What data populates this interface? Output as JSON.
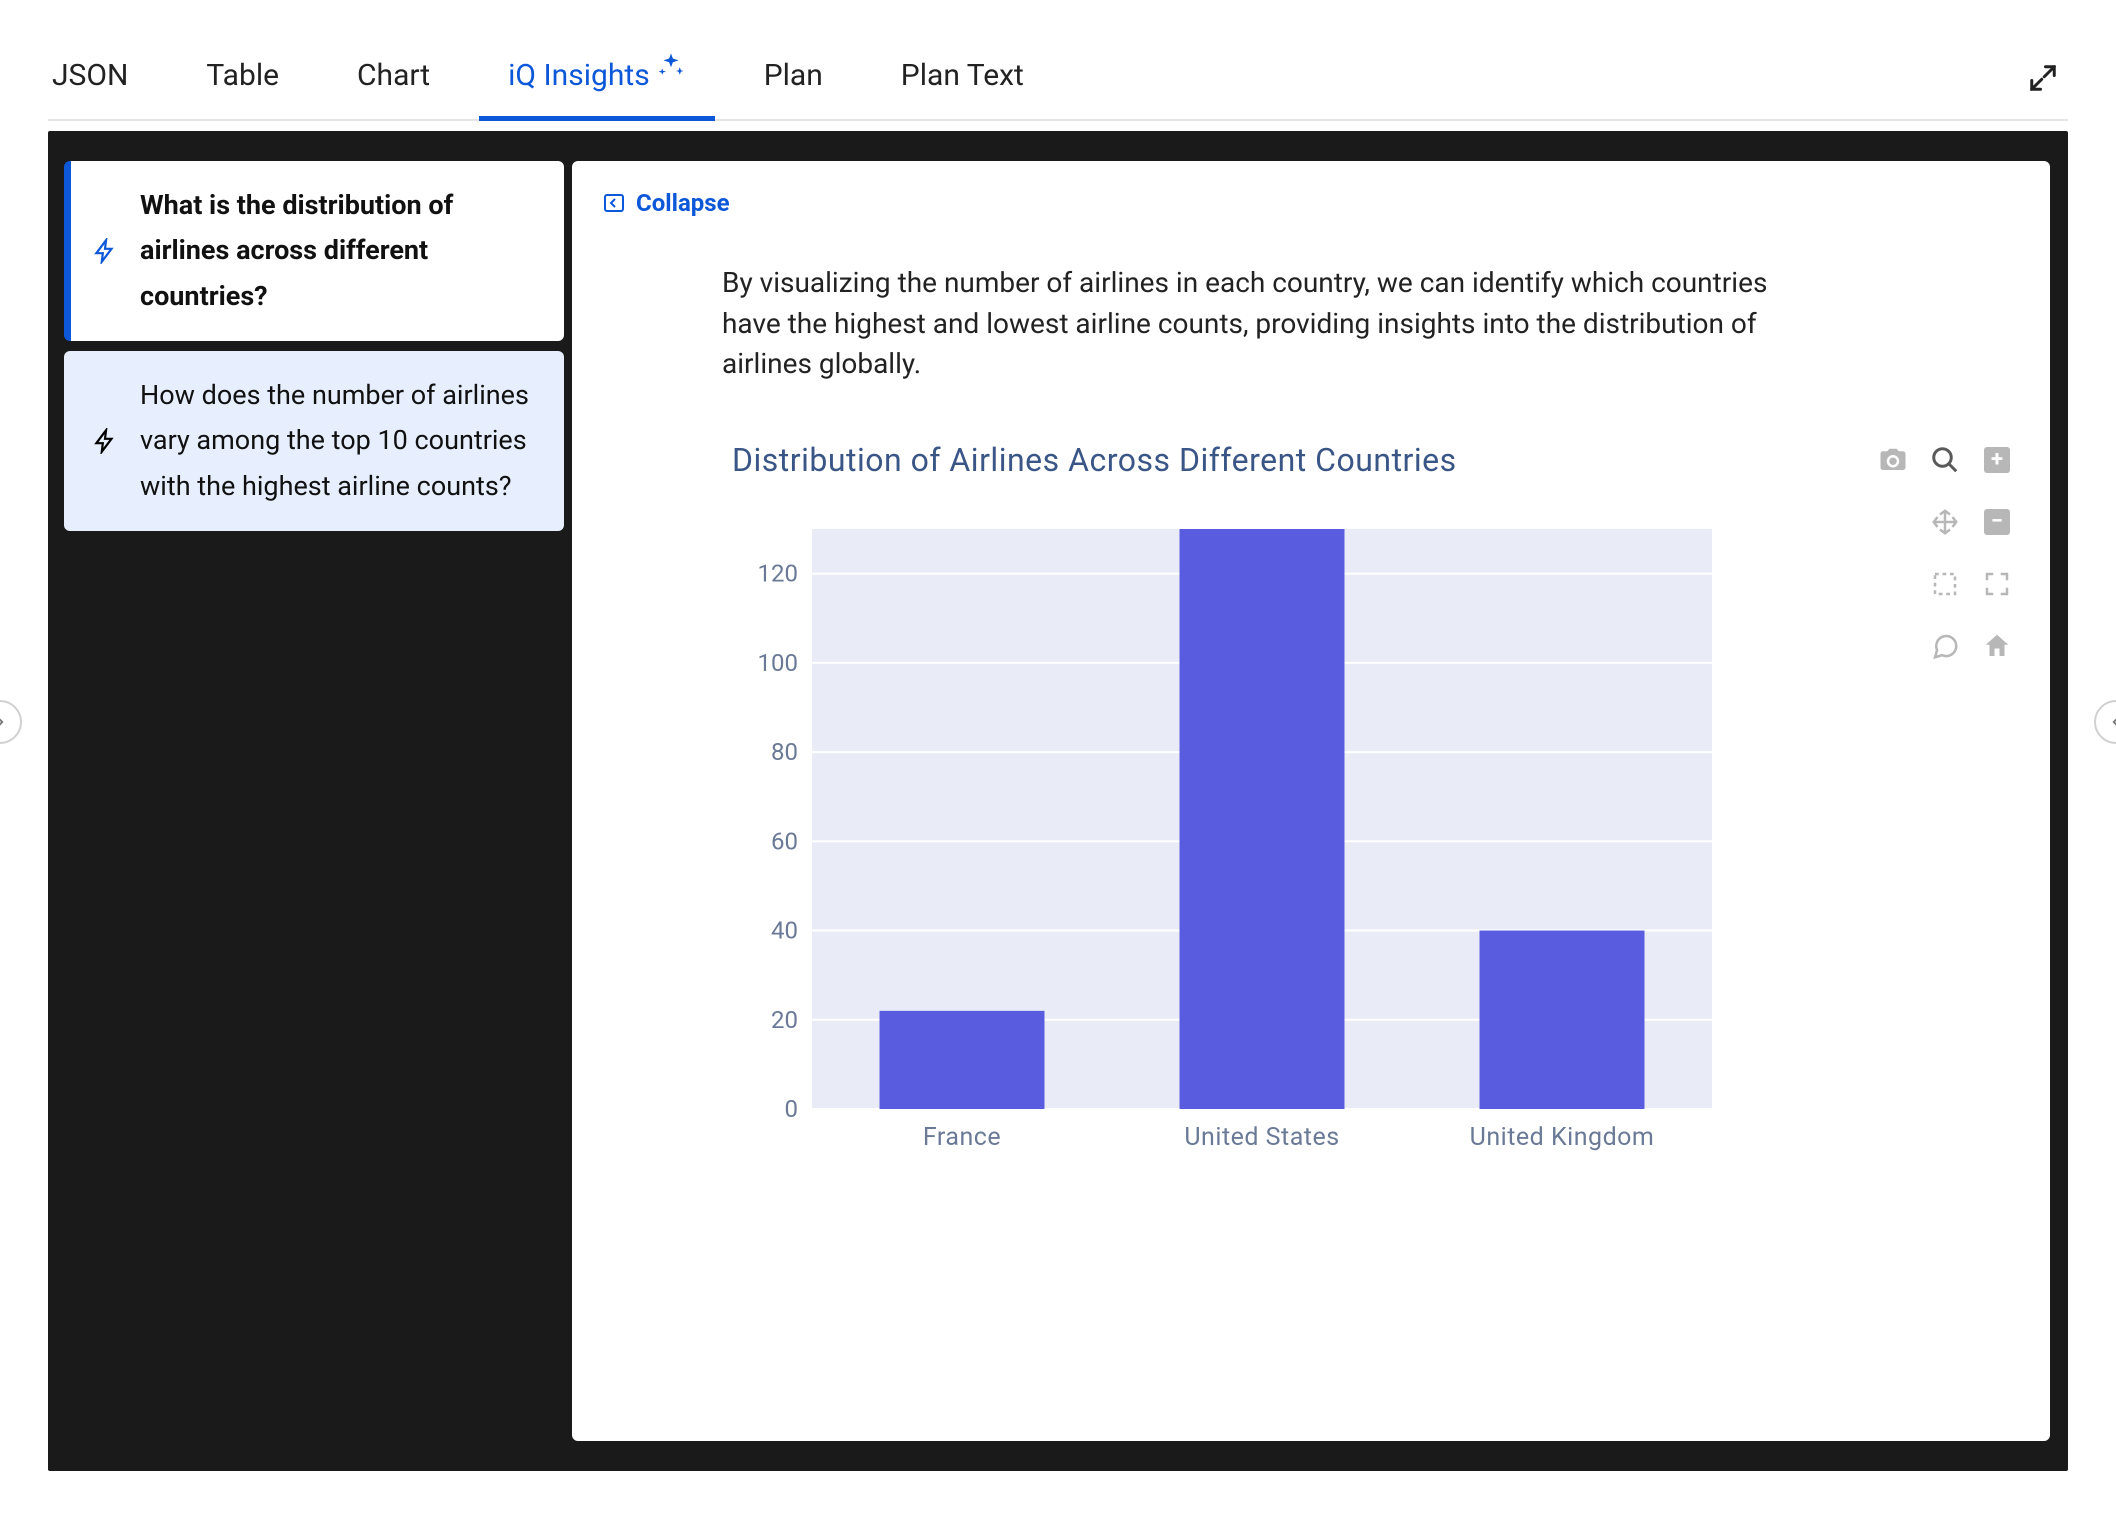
{
  "tabs": {
    "items": [
      {
        "label": "JSON"
      },
      {
        "label": "Table"
      },
      {
        "label": "Chart"
      },
      {
        "label": "iQ Insights"
      },
      {
        "label": "Plan"
      },
      {
        "label": "Plan Text"
      }
    ],
    "active_index": 3
  },
  "questions": [
    {
      "text": "What is the distribution of airlines across different countries?",
      "active": true
    },
    {
      "text": "How does the number of airlines vary among the top 10 countries with the highest airline counts?",
      "active": false
    }
  ],
  "collapse_label": "Collapse",
  "description": "By visualizing the number of airlines in each country, we can identify which countries have the highest and lowest airline counts, providing insights into the distribution of airlines globally.",
  "chart_data": {
    "type": "bar",
    "title": "Distribution of Airlines Across Different Countries",
    "categories": [
      "France",
      "United States",
      "United Kingdom"
    ],
    "values": [
      22,
      130,
      40
    ],
    "xlabel": "",
    "ylabel": "",
    "ylim": [
      0,
      130
    ],
    "yticks": [
      0,
      20,
      40,
      60,
      80,
      100,
      120
    ],
    "bar_color": "#5a5ce0",
    "plot_bg": "#e9ecf7",
    "grid_color": "#ffffff",
    "axis_text_color": "#6a7a96"
  },
  "chart_toolbar": {
    "items": [
      "camera",
      "zoom",
      "plus",
      "pan",
      "minus",
      "select",
      "fullscreen",
      "chat",
      "home"
    ]
  }
}
